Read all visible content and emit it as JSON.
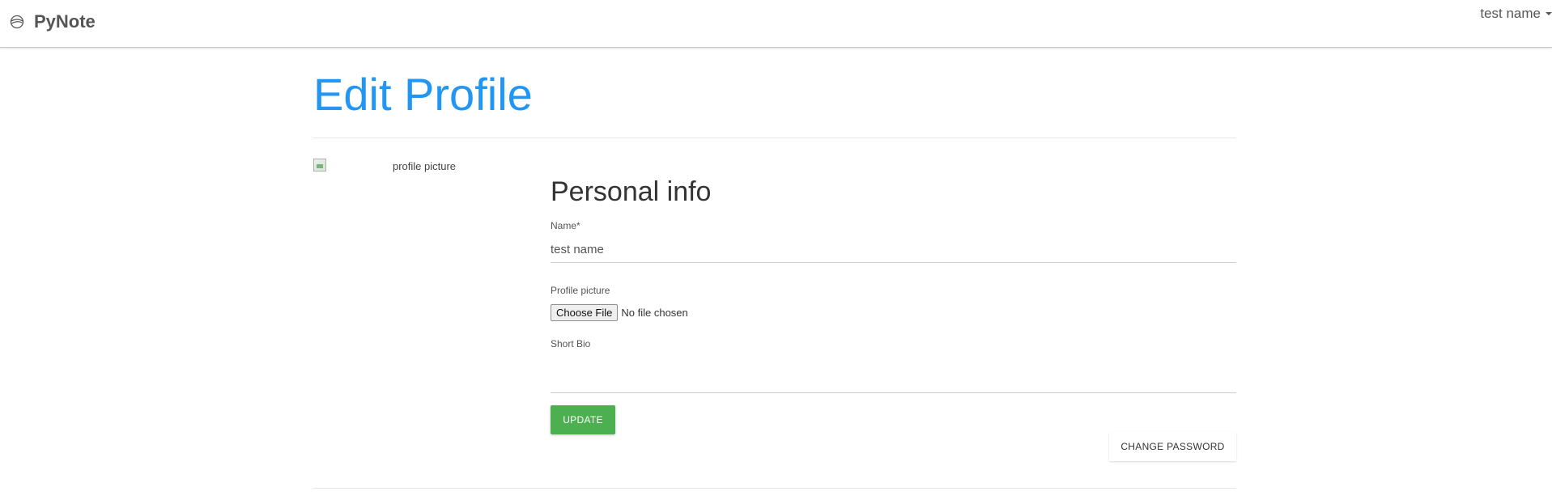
{
  "navbar": {
    "brand_icon": "globe-icon",
    "brand_name": "PyNote",
    "user_name": "test name",
    "user_menu_icon": "caret-down-icon"
  },
  "page": {
    "title": "Edit Profile"
  },
  "profile_picture": {
    "alt_text": "profile picture",
    "icon": "broken-image-icon"
  },
  "form": {
    "section_title": "Personal info",
    "name_label": "Name*",
    "name_value": "test name",
    "picture_label": "Profile picture",
    "choose_file_label": "Choose File",
    "no_file_text": "No file chosen",
    "bio_label": "Short Bio",
    "bio_value": "",
    "update_label": "UPDATE",
    "change_password_label": "CHANGE PASSWORD"
  },
  "colors": {
    "title_blue": "#2196f3",
    "update_green": "#4caf50"
  }
}
